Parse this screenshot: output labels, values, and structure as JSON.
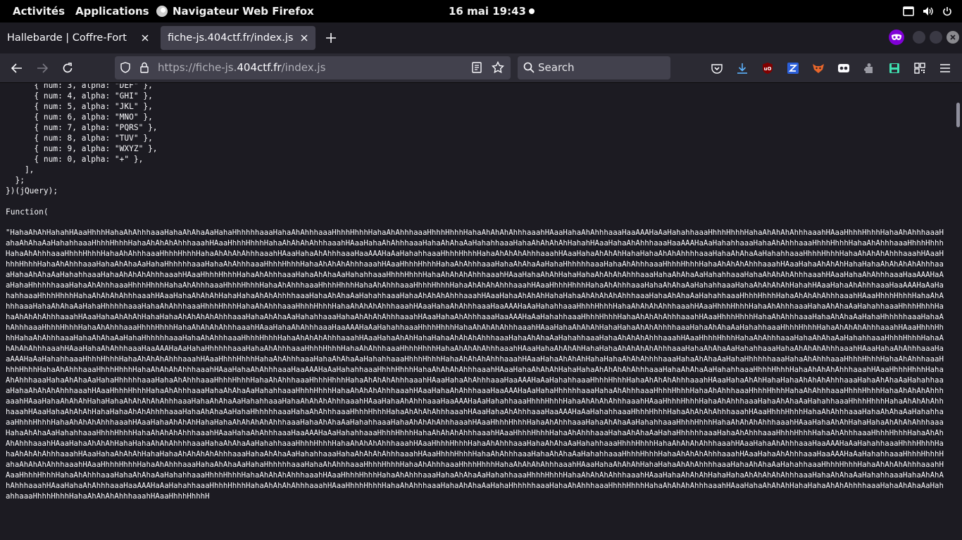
{
  "topbar": {
    "activities": "Activités",
    "applications": "Applications",
    "app_name": "Navigateur Web Firefox",
    "clock": "16 mai  19:43"
  },
  "tabs": [
    {
      "title": "Hallebarde | Coffre-Fort"
    },
    {
      "title": "fiche-js.404ctf.fr/index.js"
    }
  ],
  "navbar": {
    "url_prefix": "https://fiche-js.",
    "url_host": "404ctf.fr",
    "url_path": "/index.js",
    "search_placeholder": "Search"
  },
  "content": {
    "code_lines": "      { num: 3, alpha: \"DEF\" },\n      { num: 4, alpha: \"GHI\" },\n      { num: 5, alpha: \"JKL\" },\n      { num: 6, alpha: \"MNO\" },\n      { num: 7, alpha: \"PQRS\" },\n      { num: 8, alpha: \"TUV\" },\n      { num: 9, alpha: \"WXYZ\" },\n      { num: 0, alpha: \"+\" },\n    ],\n  };\n})(jQuery);\n\nFunction(",
    "payload": "\"HahaAhAhHahahHAaaHhhhHahaAhAhhhaaaHahaAhAhaAaHahaHhhhhhaaaHahaAhAhhhaaaHhhhHhhhHahaAhAhhhaaaHhhhHhhhHahaAhAhAhAhhhaaahHAaaHahaAhAhhhaaaHaaAAAHaAaHahahhaaaHhhhHhhhHahaAhAhAhAhhhaaahHAaaHhhhHhhhHahaAhAhhhaaaHahaAhAhaAaHahahhaaaHhhhHhhhHahaAhAhAhAhhhaaahHAaaHhhhHhhhHahaAhAhAhAhhhaaahHAaaHahaAhAhhhaaaHahaAhAhaAaHahahhaaaHahaAhAhAhAhHahahHAaaHahaAhAhhhaaaHaaAAAHaAaHahahhaaaHahaAhAhhhaaaHhhhHhhhHahaAhAhhhaaaHhhhHhhhHahaAhAhhhaaaHhhhHhhhHahaAhAhhhaaaHhhhHhhhHahaAhAhAhAhhhaaahHAaaHahaAhAhhhaaaHaaAAAHaAaHahahhaaaHhhhHhhhHahaAhAhAhAhhhaaahHAaaHahaAhAhAhHahaHahaAhAhAhhhhaaaHahaAhAhaAaHahahhaaaHhhhHhhhHahaAhAhAhAhhhaaahHAaaHhhhHhhhHahaAhAhhhaaaHahaAhAhaAaHahaHhhhhhaaaHahaAhAhhhaaaHhhhHhhhHahaAhAhAhAhhhaaahHAaaHhhhHhhhHahaAhAhhhaaaHahaAhAhaAaHahaHhhhhhaaaHahaAhAhhhaaaHhhhHhhhHahaAhAhAhAhhhaaahHAaaHahaAhAhAhHahaHahaAhAhAhAhAhhhaaaHahaAhAhaAaHahahhaaaHahaAhAhAhAhhhaaahHAaaHhhhHhhhHahaAhAhhhaaaHahaAhAhaAaHahahhaaaHhhhHhhhHahaAhAhAhAhhhaaahHAaaHahaAhAhHahaHahaAhAhAhAhhhaaaHahaAhAhaAaHahahhaaaHahaAhAhAhAhhhaaahHAaaHahaAhAhhhaaaHaaAAAHaAaHahaHhhhhhaaaHahaAhAhhhaaaHhhhHhhhHahaAhAhhhaaaHhhhHhhhHahaAhAhhhaaaHhhhHhhhHahaAhAhhhaaaHhhhHhhhHahaAhAhAhAhhhaaahHAaaHhhhHhhhHahaAhAhhhaaaHahaAhAhaAaHahahhaaaHahaAhAhAhAhHahahHAaaHahaAhAhhhaaaHaaAAAHaAaHahahhaaaHhhhHhhhHahaAhAhAhAhhhaaahHAaaHahaAhAhAhHahaHahaAhAhAhhhhaaaHahaAhAhaAaHahahhaaaHahaAhAhAhAhhhaaahHAaaHahaAhAhAhHahaHahaAhAhAhAhAhhhaaaHahaAhAhaAaHahahhaaaHhhhHhhhHahaAhAhAhAhhhaaahHAaaHhhhHhhhHahaAhAhhhaaaHahaAhAhaAaHahaHhhhhhaaaHahaAhAhhhaaaHhhhHhhhHahaAhAhhhaaaHhhhHhhhHahaAhAhAhAhhhaaahHAaaHahaAhAhhhaaaHaaAAAHaAaHahahhaaaHhhhHhhhHahaAhAhAhAhhhaaahHAaaHhhhHhhhHahaAhAhhhaaaHahaAhAhaAaHahahhaaaHhhhHhhhHahaAhAhAhAhhhaaahHAaaHahaAhAhAhHahaHahaAhAhAhAhAhhhaaaHahaAhAhaAaHahahhaaaHahaAhAhAhAhhhaaahHAaaHahaAhAhhhaaaHaaAAAHaAaHahahhaaaHhhhHhhhHahaAhAhAhAhhhaaahHAaaHhhhHhhhHahaAhAhhhaaaHahaAhAhaAaHahaHhhhhhaaaHahaAhAhhhaaaHhhhHhhhHahaAhAhhhaaaHhhhHhhhHahaAhAhAhAhhhaaahHAaaHahaAhAhhhaaaHaaAAAHaAaHahahhaaaHhhhHhhhHahaAhAhAhAhhhaaahHAaaHahaAhAhAhHahaHahaAhAhAhhhhaaaHahaAhAhaAaHahahhaaaHhhhHhhhHahaAhAhAhAhhhaaahHAaaHhhhHhhhHahaAhAhhhaaaHahaAhAhaAaHahaHhhhhhaaaHahaAhAhhhaaaHhhhHhhhHahaAhAhAhAhhhaaahHAaaHahaAhAhHahaHahaAhAhAhAhhhaaaHahaAhAhaAaHahahhaaaHahaAhAhAhAhhhaaahHAaaHhhhHhhhHahaAhAhhhaaaHahaAhAhaAaHahahhaaaHhhhHhhhHahaAhAhAhAhhhaaahHAaaHahaAhAhhhaaaHaaAAAHaAaHahaHhhhhhaaaHahaAhAhhhaaaHhhhHhhhHahaAhAhhhaaaHhhhHhhhHahaAhAhAhAhhhaaahHAaaHahaAhAhAhHahaHahaAhAhAhAhAhhhaaaHahaAhAhaAaHahahhaaaHahaAhAhAhAhhhaaahHAaaHahaAhAhhhaaaHaaAAAHaAaHahahhaaaHhhhHhhhHahaAhAhAhAhhhaaahHAaaHhhhHhhhHahaAhAhhhaaaHahaAhAhaAaHahahhaaaHhhhHhhhHahaAhAhAhAhhhaaahHAaaHahaAhAhAhHahaHahaAhAhAhhhhaaaHahaAhAhaAaHahaHhhhhhaaaHahaAhAhhhaaaHhhhHhhhHahaAhAhhhaaaHhhhHhhhHahaAhAhhhaaaHhhhHhhhHahaAhAhAhAhhhaaahHAaaHahaAhAhhhaaaHaaAAAHaAaHahahhaaaHhhhHhhhHahaAhAhAhAhhhaaahHAaaHahaAhAhAhHahaHahaAhAhAhAhAhhhaaaHahaAhAhaAaHahahhaaaHhhhHhhhHahaAhAhAhAhhhaaahHAaaHhhhHhhhHahaAhAhhhaaaHahaAhAhaAaHahaHhhhhhaaaHahaAhAhhhaaaHhhhHhhhHahaAhAhhhaaaHhhhHhhhHahaAhAhAhAhhhaaahHAaaHahaAhAhhhaaaHaaAAAHaAaHahahhaaaHhhhHhhhHahaAhAhAhAhhhaaahHAaaHahaAhAhHahaHahaAhAhAhAhhhaaaHahaAhAhaAaHahahhaaaHahaAhAhAhAhhhaaahHAaaHhhhHhhhHahaAhAhhhaaaHahaAhAhaAaHahahhaaaHhhhHhhhHahaAhAhAhAhhhaaahHAaaHahaAhAhhhaaaHaaAAAHaAaHahaHhhhhhaaaHahaAhAhhhaaaHhhhHhhhHahaAhAhhhaaaHhhhHhhhHahaAhAhhhaaaHhhhHhhhHahaAhAhAhAhhhaaahHAaaHahaAhAhAhHahaHahaAhAhAhAhAhhhaaaHahaAhAhaAaHahahhaaaHahaAhAhAhAhhhaaahHAaaHahaAhAhhhaaaHaaAAAHaAaHahahhaaaHhhhHhhhHahaAhAhAhAhhhaaahHAaaHhhhHhhhHahaAhAhhhaaaHahaAhAhaAaHahahhaaaHhhhHhhhHahaAhAhAhAhhhaaahHAaaHahaAhAhAhHahaHahaAhAhAhhhhaaaHahaAhAhaAaHahaHhhhhhaaaHahaAhAhhhaaaHhhhHhhhHahaAhAhAhAhhhaaahHAaaHahaAhAhhhaaaHaaAAAHaAaHahahhaaaHhhhHhhhHahaAhAhAhAhhhaaahHAaaHhhhHhhhHahaAhAhhhaaaHahaAhAhaAaHahahhaaaHhhhHhhhHahaAhAhAhAhhhaaahHAaaHahaAhAhAhHahaHahaAhAhAhAhAhhhaaaHahaAhAhaAaHahahhaaaHahaAhAhAhAhhhaaahHAaaHhhhHhhhHahaAhAhhhaaaHahaAhAhaAaHahahhaaaHhhhHhhhHahaAhAhAhAhhhaaahHAaaHahaAhAhHahaHahaAhAhAhAhhhaaaHahaAhAhaAaHahahhaaaHhhhHhhhHahaAhAhAhAhhhaaahHAaaHahaAhAhhhaaaHaaAAAHaAaHahahhaaaHhhhHhhhHahaAhAhAhAhhhaaahHAaaHhhhHhhhHahaAhAhhhaaaHahaAhAhaAaHahaHhhhhhaaaHahaAhAhhhaaaHhhhHhhhHahaAhAhhhaaaHhhhHhhhHahaAhAhAhAhhhaaahHAaaHahaAhAhAhHahaHahaAhAhAhhhhaaaHahaAhAhaAaHahahhaaaHhhhHhhhHahaAhAhAhAhhhaaahHAaaHhhhHhhhHahaAhAhhhaaaHahaAhAhaAaHahahhaaaHhhhHhhhHahaAhAhAhAhhhaaahHAaaHahaAhAhhhaaaHaaAAAHaAaHahahhaaaHhhhHhhhHahaAhAhAhAhhhaaahHAaaHahaAhAhAhHahaHahaAhAhAhAhAhhhaaaHahaAhAhaAaHahahhaaaHahaAhAhAhAhhhaaahHAaaHhhhHhhhHahaAhAhhhaaaHahaAhAhaAaHahahhaaaHhhhHhhhHahaAhAhAhAhhhaaahHAaaHahaAhAhhhaaaHaaAAAHaAaHahahhaaaHhhhHhhhHahaAhAhAhAhhhaaahHAaaHhhhHhhhHahaAhAhhhaaaHahaAhAhaAaHahaHhhhhhaaaHahaAhAhhhaaaHhhhHhhhHahaAhAhhhaaaHhhhHhhhHahaAhAhAhAhhhaaahHAaaHahaAhAhAhHahaHahaAhAhAhhhhaaaHahaAhAhaAaHahahhaaaHhhhHhhhHahaAhAhAhAhhhaaahHAaaHhhhHhhhHahaAhAhhhaaaHahaAhAhaAaHahahhaaaHhhhHhhhHahaAhAhAhAhhhaaahHAaaHhhhHhhhHahaAhAhhhaaaHahaAhAhaAaHahahhaaaHhhhHhhhHahaAhAhAhAhhhaaahHAaaHahaAhAhAhHahaHahaAhAhAhAhAhhhaaaHahaAhAhaAaHahahhaaaHahaAhAhAhAhhhaaahHAaaHahaAhAhhhaaaHaaAAAHaAaHahahhaaaHhhhHhhhHahaAhAhAhAhhhaaahHAaaHhhhHhhhHahaAhAhhhaaaHahaAhAhaAaHahaHhhhhhaaaHahaAhAhhhaaaHhhhHhhhHahaAhAhAhAhhhaaahHAaaHahaAhAhAhHahaHahaAhAhAhhhhaaaHahaAhAhaAaHahahhaaaHhhhHhhhHahaAhAhAhAhhhaaahHAaaHhhhHhhhH"
  },
  "colors": {
    "topbar_bg": "#000000",
    "toolbar_bg": "#2b2a33",
    "content_bg": "#1c1b22",
    "active_tab": "#42414d",
    "private_badge": "#8000d7"
  },
  "icons": [
    "firefox-icon",
    "screen-icon",
    "volume-icon",
    "power-icon",
    "close-icon",
    "plus-icon",
    "private-browsing-icon",
    "back-icon",
    "forward-icon",
    "reload-icon",
    "shield-icon",
    "lock-icon",
    "reader-mode-icon",
    "star-icon",
    "search-icon",
    "pocket-icon",
    "download-icon",
    "ublock-icon",
    "extension-z-icon",
    "extension-fox-icon",
    "extension-mask-icon",
    "extension-puzzle-icon",
    "save-icon",
    "qr-icon",
    "menu-icon"
  ]
}
